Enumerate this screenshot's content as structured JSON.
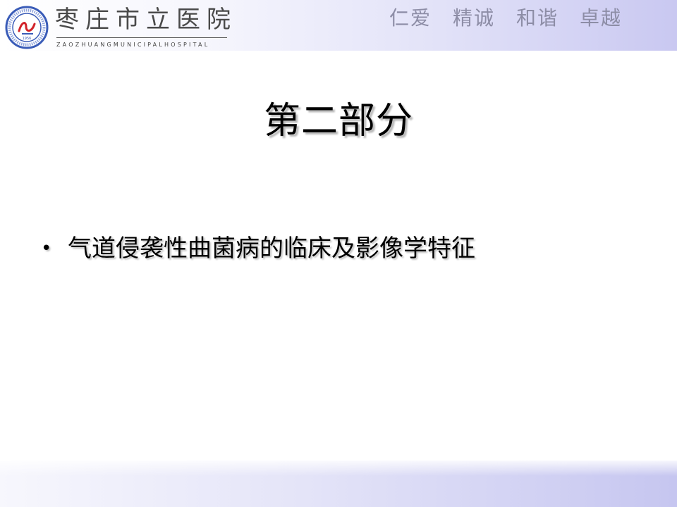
{
  "header": {
    "hospital_name": "枣庄市立医院",
    "hospital_english": "ZAOZHUANGMUNICIPALHOSPITAL",
    "motto": [
      "仁爱",
      "精诚",
      "和谐",
      "卓越"
    ],
    "logo": {
      "seal_text": "枣庄市立医院 ZAOZHUANG MUNICIPAL HOSPITAL",
      "seal_year": "1956"
    }
  },
  "slide": {
    "title": "第二部分",
    "bullets": [
      {
        "marker": "•",
        "text": "气道侵袭性曲菌病的临床及影像学特征"
      }
    ]
  },
  "colors": {
    "band_light": "#f6f6fd",
    "band_dark": "#c9c8f1",
    "motto_text": "#8d8da6",
    "logo_blue": "#3a5cb8",
    "logo_red": "#d2232a"
  }
}
